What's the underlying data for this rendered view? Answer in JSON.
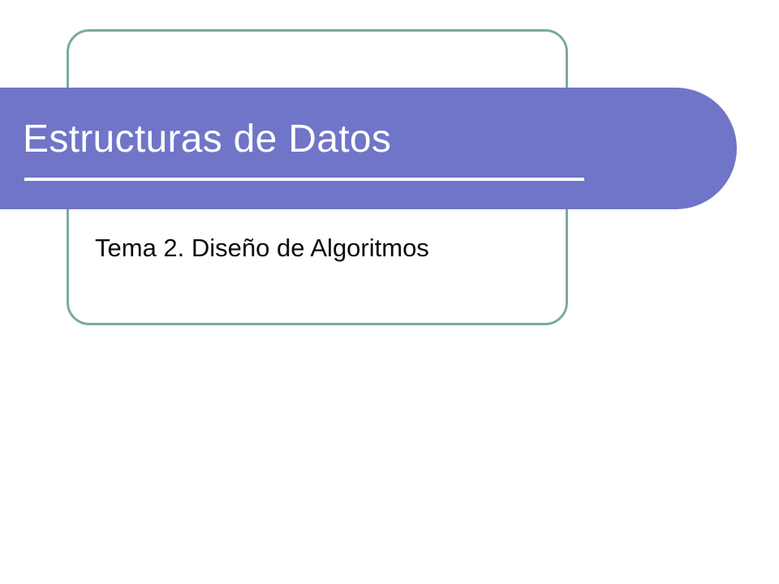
{
  "slide": {
    "title": "Estructuras de Datos",
    "subtitle": "Tema 2. Diseño de Algoritmos"
  },
  "colors": {
    "title_bar": "#7075c8",
    "frame_border": "#7aa9a3",
    "title_text": "#ffffff",
    "subtitle_text": "#0b0b0b"
  }
}
